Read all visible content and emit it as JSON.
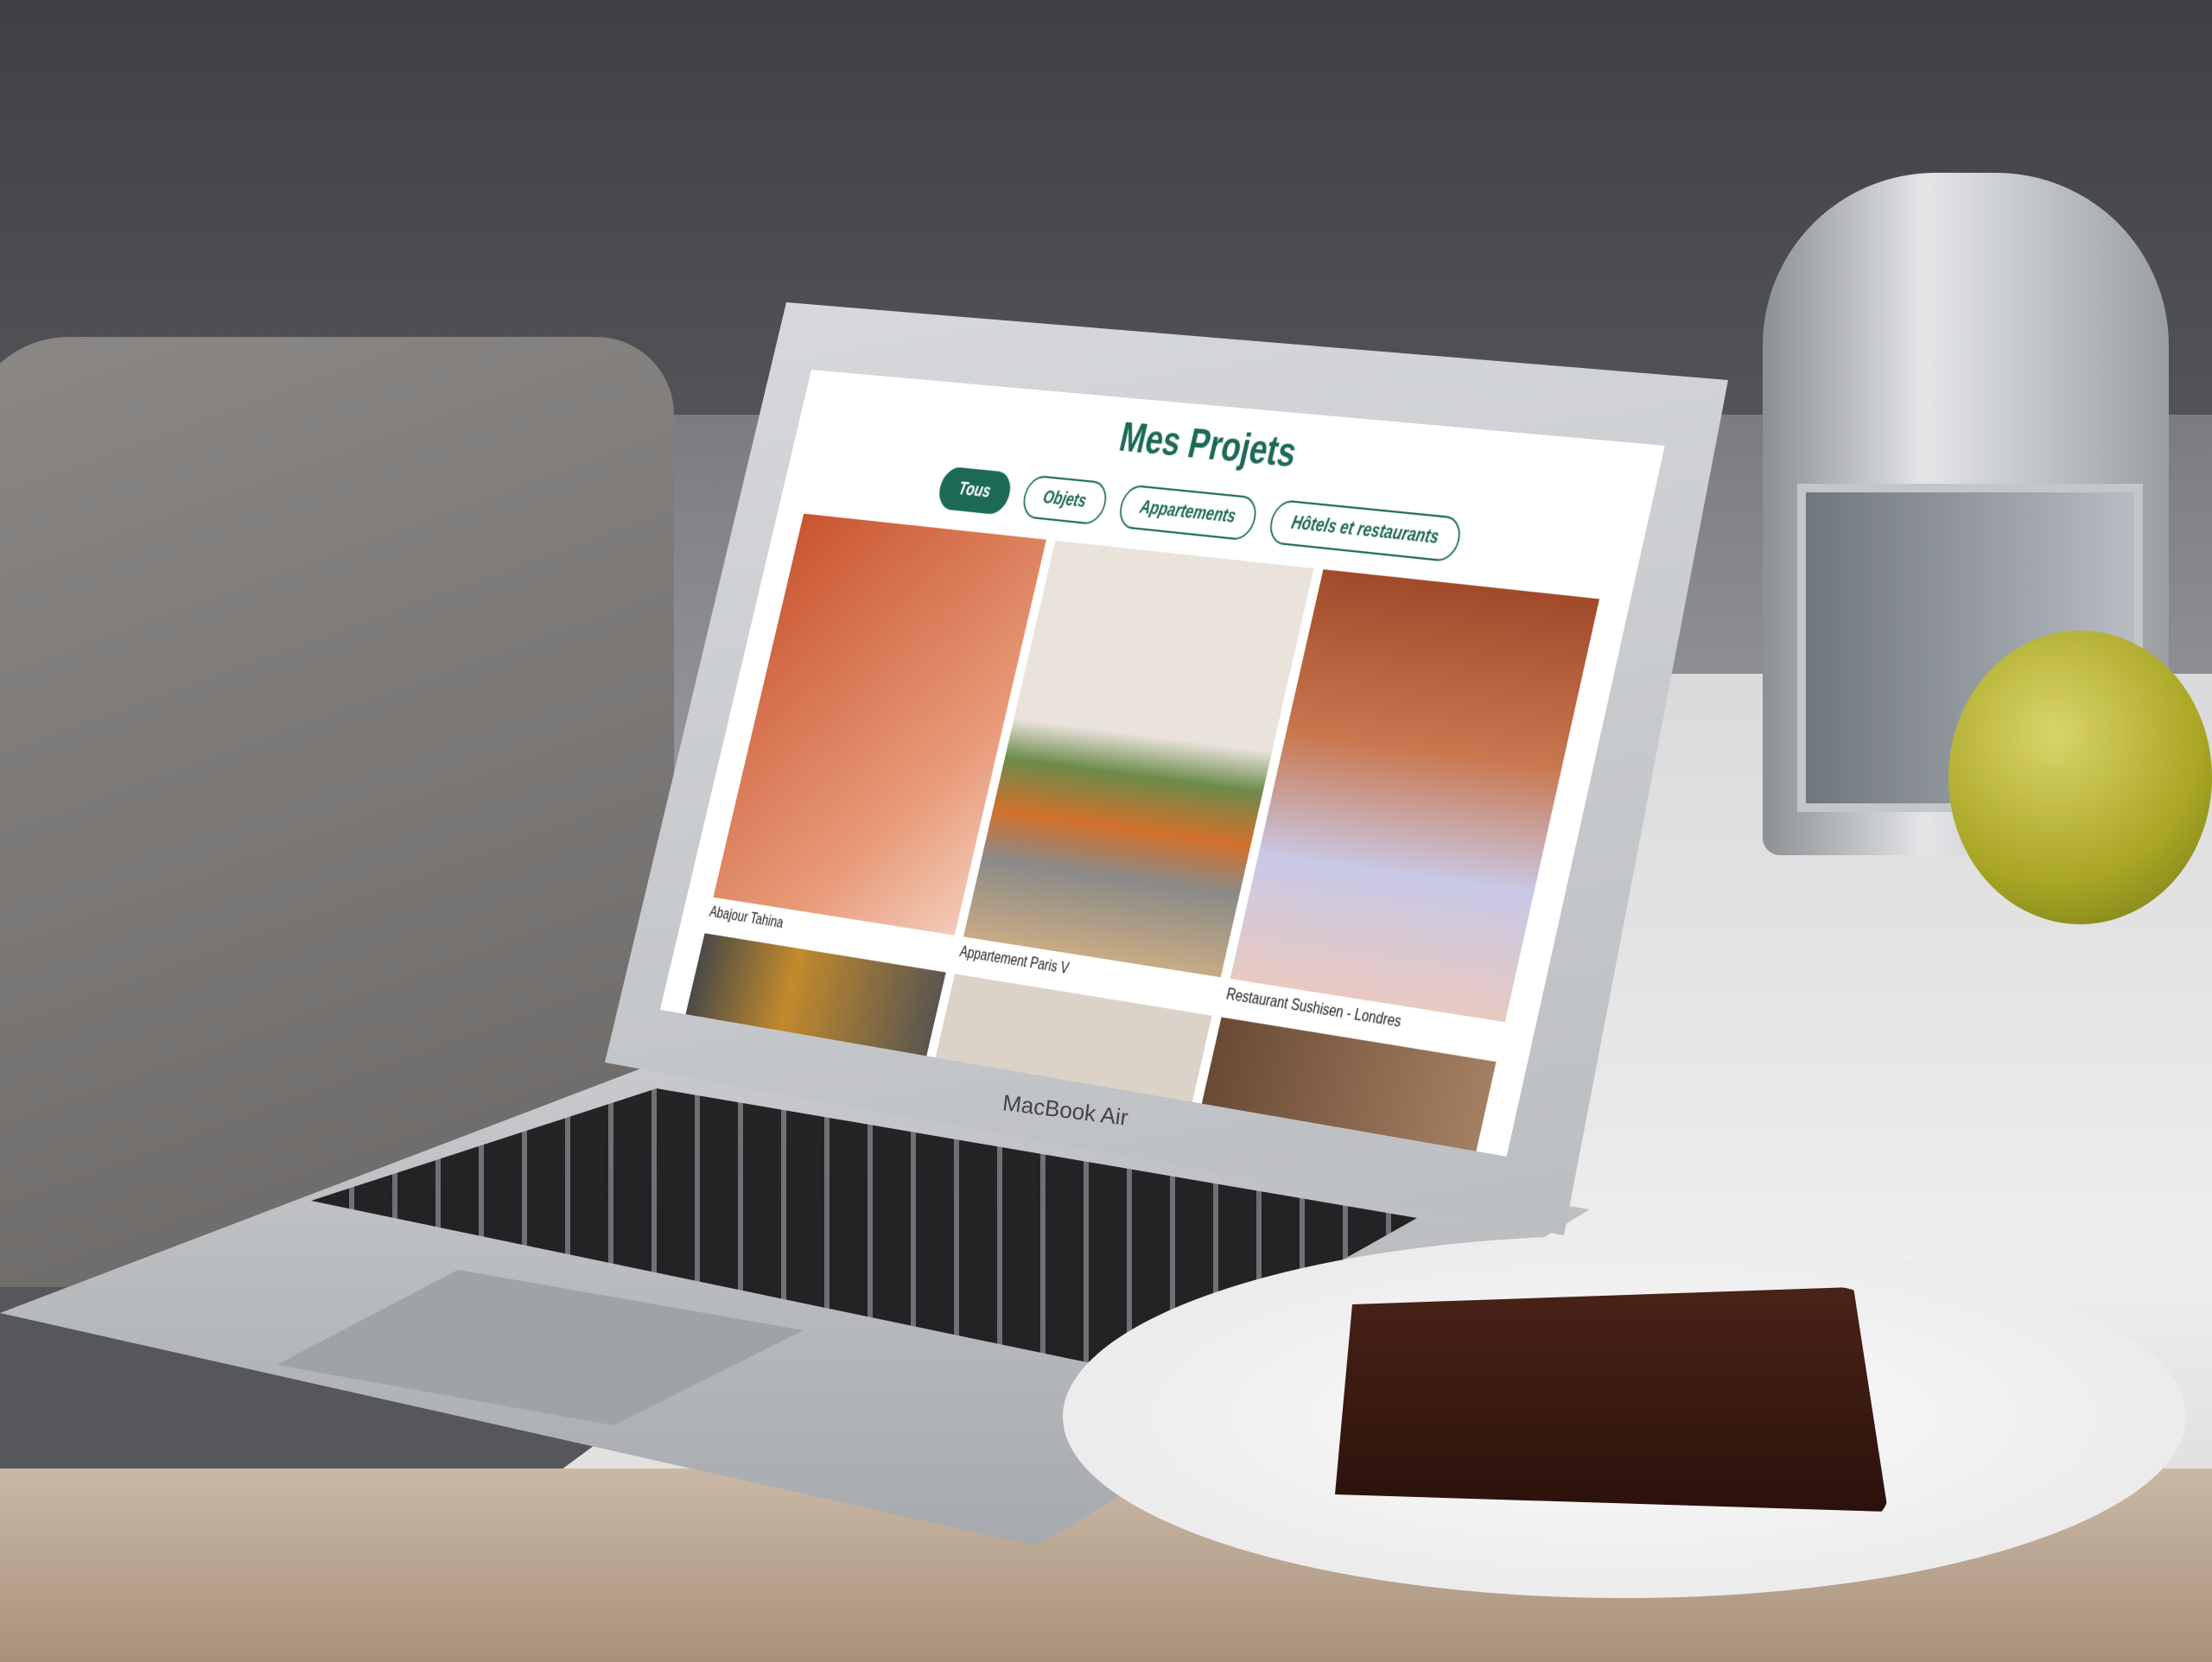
{
  "page": {
    "title": "Mes Projets"
  },
  "filters": [
    {
      "label": "Tous",
      "active": true
    },
    {
      "label": "Objets",
      "active": false
    },
    {
      "label": "Appartements",
      "active": false
    },
    {
      "label": "Hôtels et restaurants",
      "active": false
    }
  ],
  "projects": [
    {
      "caption": "Abajour Tahina"
    },
    {
      "caption": "Appartement Paris V"
    },
    {
      "caption": "Restaurant Sushisen - Londres"
    }
  ],
  "device": {
    "brand": "MacBook Air"
  },
  "colors": {
    "accent": "#1c6a55"
  }
}
